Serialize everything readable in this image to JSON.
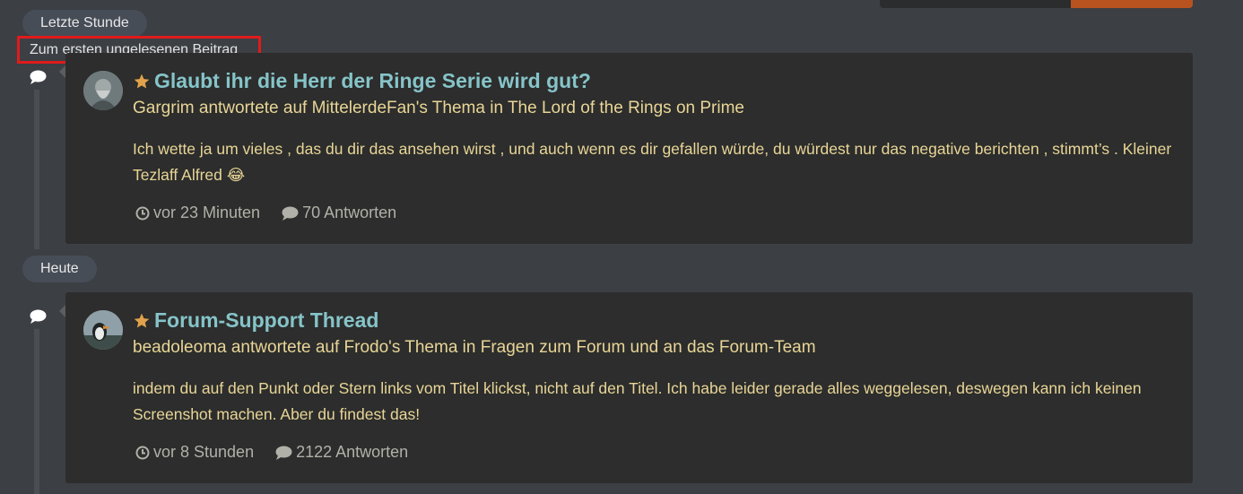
{
  "colors": {
    "accent": "#b8531f",
    "link": "#86c4c9",
    "text": "#e9d597",
    "highlight_border": "#e01b1b",
    "star": "#e1a24c"
  },
  "timeline": {
    "last_hour_label": "Letzte Stunde",
    "today_label": "Heute",
    "unread_jump_label": "Zum ersten ungelesenen Beitrag"
  },
  "entries": [
    {
      "icon": "comment-icon",
      "title": "Glaubt ihr die Herr der Ringe Serie wird gut?",
      "subtitle": "Gargrim antwortete auf MittelerdeFan's Thema in The Lord of the Rings on Prime",
      "excerpt": "Ich wette ja um vieles , das du dir das ansehen wirst , und auch wenn es dir gefallen würde, du würdest nur das negative berichten , stimmt’s . Kleiner Tezlaff Alfred 😂",
      "time": "vor 23 Minuten",
      "replies": "70 Antworten"
    },
    {
      "icon": "comment-icon",
      "title": "Forum-Support Thread",
      "subtitle": "beadoleoma antwortete auf Frodo's Thema in Fragen zum Forum und an das Forum-Team",
      "excerpt": "indem du auf den Punkt oder Stern links vom Titel klickst, nicht auf den Titel. Ich habe leider gerade alles weggelesen, deswegen kann ich keinen Screenshot machen. Aber du findest das!",
      "time": "vor 8 Stunden",
      "replies": "2122 Antworten"
    }
  ]
}
